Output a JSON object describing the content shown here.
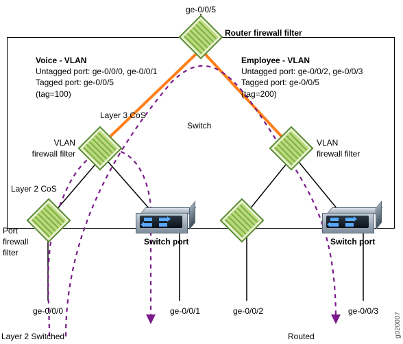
{
  "top_port": "ge-0/0/5",
  "router_label": "Router firewall filter",
  "voice": {
    "title": "Voice - VLAN",
    "line1": "Untagged port: ge-0/0/0, ge-0/0/1",
    "line2": "Tagged port: ge-0/0/5",
    "line3": "(tag=100)"
  },
  "employee": {
    "title": "Employee - VLAN",
    "line1": "Untagged port: ge-0/0/2, ge-0/0/3",
    "line2": "Tagged port: ge-0/0/5",
    "line3": "(tag=200)"
  },
  "layer3": "Layer 3 CoS",
  "switch_label": "Switch",
  "vlan_left": "VLAN\nfirewall filter",
  "vlan_right": "VLAN\nfirewall filter",
  "layer2": "Layer 2 CoS",
  "port_label": "Port\nfirewall\nfilter",
  "switch_port": "Switch port",
  "ports": {
    "p0": "ge-0/0/0",
    "p1": "ge-0/0/1",
    "p2": "ge-0/0/2",
    "p3": "ge-0/0/3"
  },
  "bottom_left": "Layer 2 Switched",
  "bottom_right": "Routed",
  "imgid": "g020007",
  "colors": {
    "orange": "#ff7f1a",
    "purple": "#7b1b8b"
  }
}
